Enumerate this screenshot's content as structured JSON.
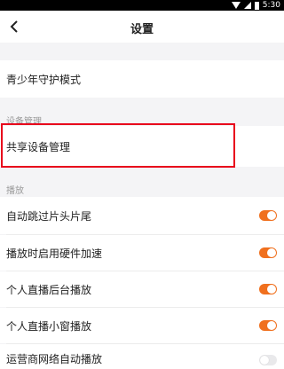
{
  "status_bar": {
    "time": "5:30",
    "wifi_icon": "wifi-icon",
    "signal_icon": "signal-icon",
    "battery_icon": "battery-icon"
  },
  "nav": {
    "title": "设置",
    "back_icon": "chevron-left-icon"
  },
  "rows": {
    "teen_mode": "青少年守护模式",
    "device_section": "设备管理",
    "shared_device": "共享设备管理",
    "playback_section": "播放",
    "auto_skip": "自动跳过片头片尾",
    "hw_accel": "播放时启用硬件加速",
    "live_bg": "个人直播后台播放",
    "live_pip": "个人直播小窗播放",
    "carrier_auto": "运营商网络自动播放"
  },
  "toggles": {
    "auto_skip": true,
    "hw_accel": true,
    "live_bg": true,
    "live_pip": true,
    "carrier_auto": false
  },
  "colors": {
    "accent": "#f0701e",
    "highlight_border": "#e8001b"
  }
}
